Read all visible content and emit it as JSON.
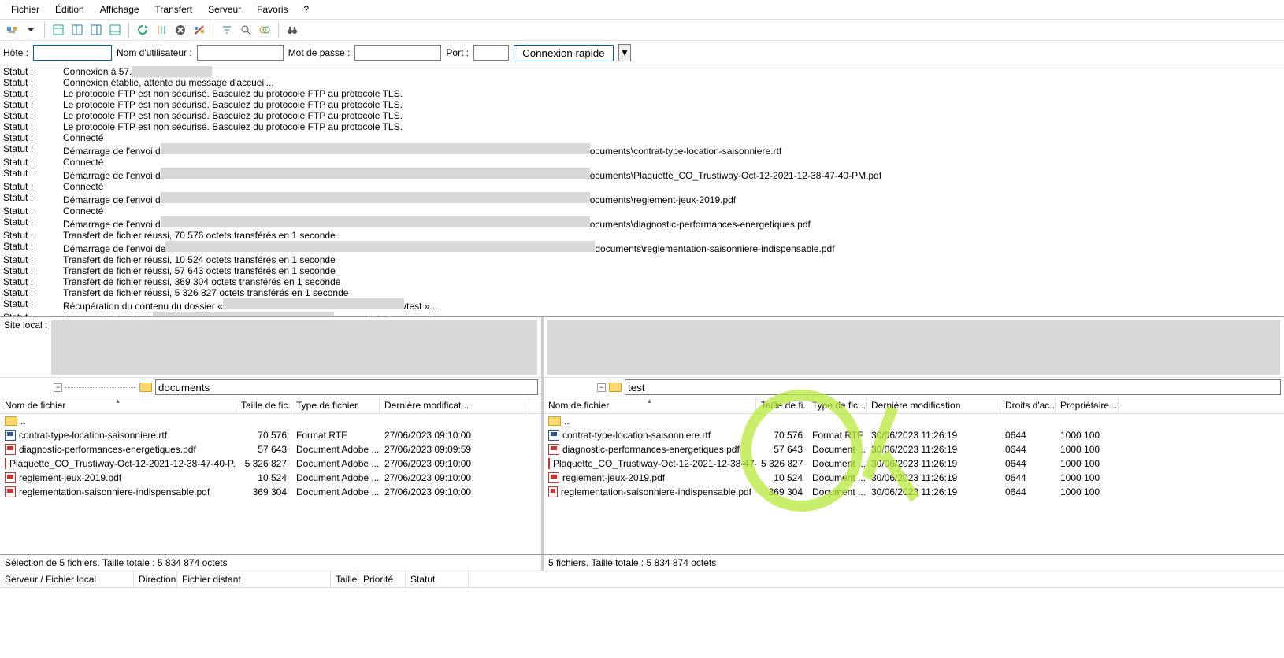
{
  "menu": [
    "Fichier",
    "Édition",
    "Affichage",
    "Transfert",
    "Serveur",
    "Favoris",
    "?"
  ],
  "conn": {
    "host_label": "Hôte :",
    "user_label": "Nom d'utilisateur :",
    "pass_label": "Mot de passe :",
    "port_label": "Port :",
    "quick_label": "Connexion rapide"
  },
  "log_label": "Statut :",
  "log": [
    "Connexion à 57.",
    "Connexion établie, attente du message d'accueil...",
    "Le protocole FTP est non sécurisé. Basculez du protocole FTP au protocole TLS.",
    "Le protocole FTP est non sécurisé. Basculez du protocole FTP au protocole TLS.",
    "Le protocole FTP est non sécurisé. Basculez du protocole FTP au protocole TLS.",
    "Le protocole FTP est non sécurisé. Basculez du protocole FTP au protocole TLS.",
    "Connecté",
    "Démarrage de l'envoi d",
    "Connecté",
    "Démarrage de l'envoi d",
    "Connecté",
    "Démarrage de l'envoi d",
    "Connecté",
    "Démarrage de l'envoi d",
    "Transfert de fichier réussi, 70 576 octets transférés en 1 seconde",
    "Démarrage de l'envoi de",
    "Transfert de fichier réussi, 10 524 octets transférés en 1 seconde",
    "Transfert de fichier réussi, 57 643 octets transférés en 1 seconde",
    "Transfert de fichier réussi, 369 304 octets transférés en 1 seconde",
    "Transfert de fichier réussi, 5 326 827 octets transférés en 1 seconde",
    "Récupération du contenu du dossier «",
    "Contenu du dossier «"
  ],
  "log_tails": {
    "7": "ocuments\\contrat-type-location-saisonniere.rtf",
    "9": "ocuments\\Plaquette_CO_Trustiway-Oct-12-2021-12-38-47-40-PM.pdf",
    "11": "ocuments\\reglement-jeux-2019.pdf",
    "13": "ocuments\\diagnostic-performances-energetiques.pdf",
    "15": "documents\\reglementation-saisonniere-indispensable.pdf",
    "20": "/test »...",
    "21": "test » affiché avec succès"
  },
  "site_local_label": "Site local :",
  "local_dir": "documents",
  "remote_dir": "test",
  "cols_local": [
    "Nom de fichier",
    "Taille de fic...",
    "Type de fichier",
    "Dernière modificat..."
  ],
  "cols_remote": [
    "Nom de fichier",
    "Taille de fi...",
    "Type de fic...",
    "Dernière modification",
    "Droits d'ac...",
    "Propriétaire..."
  ],
  "up_label": "..",
  "local_files": [
    {
      "ico": "rtf",
      "name": "contrat-type-location-saisonniere.rtf",
      "size": "70 576",
      "type": "Format RTF",
      "date": "27/06/2023 09:10:00"
    },
    {
      "ico": "pdf",
      "name": "diagnostic-performances-energetiques.pdf",
      "size": "57 643",
      "type": "Document Adobe ...",
      "date": "27/06/2023 09:09:59"
    },
    {
      "ico": "pdf",
      "name": "Plaquette_CO_Trustiway-Oct-12-2021-12-38-47-40-P...",
      "size": "5 326 827",
      "type": "Document Adobe ...",
      "date": "27/06/2023 09:10:00"
    },
    {
      "ico": "pdf",
      "name": "reglement-jeux-2019.pdf",
      "size": "10 524",
      "type": "Document Adobe ...",
      "date": "27/06/2023 09:10:00"
    },
    {
      "ico": "pdf",
      "name": "reglementation-saisonniere-indispensable.pdf",
      "size": "369 304",
      "type": "Document Adobe ...",
      "date": "27/06/2023 09:10:00"
    }
  ],
  "remote_files": [
    {
      "ico": "rtf",
      "name": "contrat-type-location-saisonniere.rtf",
      "size": "70 576",
      "type": "Format RTF",
      "date": "30/06/2023 11:26:19",
      "perm": "0644",
      "own": "1000 100"
    },
    {
      "ico": "pdf",
      "name": "diagnostic-performances-energetiques.pdf",
      "size": "57 643",
      "type": "Document ...",
      "date": "30/06/2023 11:26:19",
      "perm": "0644",
      "own": "1000 100"
    },
    {
      "ico": "pdf",
      "name": "Plaquette_CO_Trustiway-Oct-12-2021-12-38-47-...",
      "size": "5 326 827",
      "type": "Document ...",
      "date": "30/06/2023 11:26:19",
      "perm": "0644",
      "own": "1000 100"
    },
    {
      "ico": "pdf",
      "name": "reglement-jeux-2019.pdf",
      "size": "10 524",
      "type": "Document ...",
      "date": "30/06/2023 11:26:19",
      "perm": "0644",
      "own": "1000 100"
    },
    {
      "ico": "pdf",
      "name": "reglementation-saisonniere-indispensable.pdf",
      "size": "369 304",
      "type": "Document ...",
      "date": "30/06/2023 11:26:19",
      "perm": "0644",
      "own": "1000 100"
    }
  ],
  "status_local": "Sélection de 5 fichiers. Taille totale : 5 834 874 octets",
  "status_remote": "5 fichiers. Taille totale : 5 834 874 octets",
  "queue_cols": [
    "Serveur / Fichier local",
    "Direction",
    "Fichier distant",
    "Taille",
    "Priorité",
    "Statut"
  ]
}
